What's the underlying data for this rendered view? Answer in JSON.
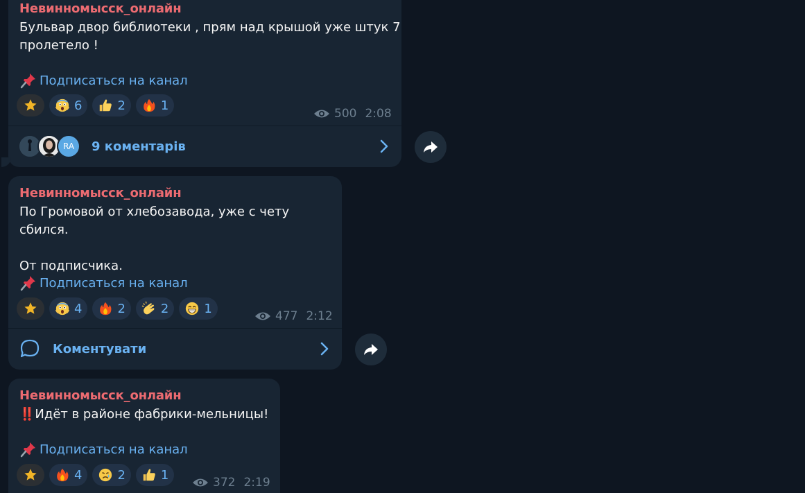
{
  "messages": [
    {
      "sender": "Невинномысск_онлайн",
      "text": "Бульвар двор библиотеки , прям над крышой уже штук 7\nпролетело !",
      "subscribe_label": "Подписаться на канал",
      "reactions": [
        {
          "icon": "star-icon",
          "count": ""
        },
        {
          "icon": "scream-emoji",
          "count": "6"
        },
        {
          "icon": "thumbs-up-emoji",
          "count": "2"
        },
        {
          "icon": "fire-emoji",
          "count": "1"
        }
      ],
      "views": "500",
      "time": "2:08",
      "comments_label": "9 коментарів",
      "avatar_initials": "RA"
    },
    {
      "sender": "Невинномысск_онлайн",
      "text": "По Громовой от хлебозавода, уже с чету сбился.\n\nОт подписчика.",
      "subscribe_label": "Подписаться на канал",
      "reactions": [
        {
          "icon": "star-icon",
          "count": ""
        },
        {
          "icon": "scream-emoji",
          "count": "4"
        },
        {
          "icon": "fire-emoji",
          "count": "2"
        },
        {
          "icon": "clap-emoji",
          "count": "2"
        },
        {
          "icon": "grin-emoji",
          "count": "1"
        }
      ],
      "views": "477",
      "time": "2:12",
      "comments_label": "Коментувати"
    },
    {
      "sender": "Невинномысск_онлайн",
      "text": "‼️Идёт в районе фабрики-мельницы!",
      "subscribe_label": "Подписаться на канал",
      "reactions": [
        {
          "icon": "star-icon",
          "count": ""
        },
        {
          "icon": "fire-emoji",
          "count": "4"
        },
        {
          "icon": "cry-emoji",
          "count": "2"
        },
        {
          "icon": "thumbs-up-emoji",
          "count": "1"
        }
      ],
      "views": "372",
      "time": "2:19"
    }
  ],
  "colors": {
    "background": "#0e1621",
    "bubble": "#182533",
    "sender": "#ec6b71",
    "link": "#6ab2f2",
    "meta": "#6d7f8f"
  }
}
